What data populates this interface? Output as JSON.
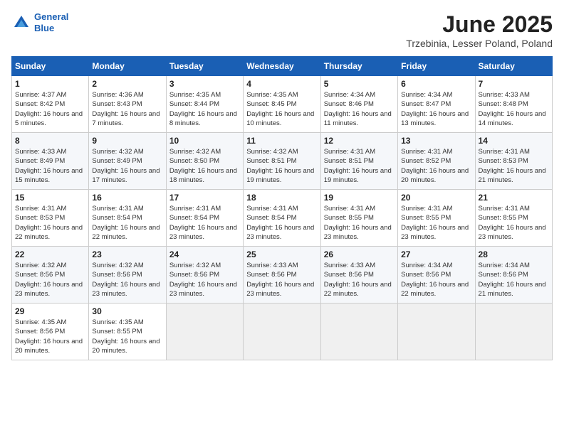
{
  "header": {
    "logo_line1": "General",
    "logo_line2": "Blue",
    "month": "June 2025",
    "location": "Trzebinia, Lesser Poland, Poland"
  },
  "columns": [
    "Sunday",
    "Monday",
    "Tuesday",
    "Wednesday",
    "Thursday",
    "Friday",
    "Saturday"
  ],
  "weeks": [
    [
      {
        "day": "1",
        "sunrise": "4:37 AM",
        "sunset": "8:42 PM",
        "daylight": "16 hours and 5 minutes."
      },
      {
        "day": "2",
        "sunrise": "4:36 AM",
        "sunset": "8:43 PM",
        "daylight": "16 hours and 7 minutes."
      },
      {
        "day": "3",
        "sunrise": "4:35 AM",
        "sunset": "8:44 PM",
        "daylight": "16 hours and 8 minutes."
      },
      {
        "day": "4",
        "sunrise": "4:35 AM",
        "sunset": "8:45 PM",
        "daylight": "16 hours and 10 minutes."
      },
      {
        "day": "5",
        "sunrise": "4:34 AM",
        "sunset": "8:46 PM",
        "daylight": "16 hours and 11 minutes."
      },
      {
        "day": "6",
        "sunrise": "4:34 AM",
        "sunset": "8:47 PM",
        "daylight": "16 hours and 13 minutes."
      },
      {
        "day": "7",
        "sunrise": "4:33 AM",
        "sunset": "8:48 PM",
        "daylight": "16 hours and 14 minutes."
      }
    ],
    [
      {
        "day": "8",
        "sunrise": "4:33 AM",
        "sunset": "8:49 PM",
        "daylight": "16 hours and 15 minutes."
      },
      {
        "day": "9",
        "sunrise": "4:32 AM",
        "sunset": "8:49 PM",
        "daylight": "16 hours and 17 minutes."
      },
      {
        "day": "10",
        "sunrise": "4:32 AM",
        "sunset": "8:50 PM",
        "daylight": "16 hours and 18 minutes."
      },
      {
        "day": "11",
        "sunrise": "4:32 AM",
        "sunset": "8:51 PM",
        "daylight": "16 hours and 19 minutes."
      },
      {
        "day": "12",
        "sunrise": "4:31 AM",
        "sunset": "8:51 PM",
        "daylight": "16 hours and 19 minutes."
      },
      {
        "day": "13",
        "sunrise": "4:31 AM",
        "sunset": "8:52 PM",
        "daylight": "16 hours and 20 minutes."
      },
      {
        "day": "14",
        "sunrise": "4:31 AM",
        "sunset": "8:53 PM",
        "daylight": "16 hours and 21 minutes."
      }
    ],
    [
      {
        "day": "15",
        "sunrise": "4:31 AM",
        "sunset": "8:53 PM",
        "daylight": "16 hours and 22 minutes."
      },
      {
        "day": "16",
        "sunrise": "4:31 AM",
        "sunset": "8:54 PM",
        "daylight": "16 hours and 22 minutes."
      },
      {
        "day": "17",
        "sunrise": "4:31 AM",
        "sunset": "8:54 PM",
        "daylight": "16 hours and 23 minutes."
      },
      {
        "day": "18",
        "sunrise": "4:31 AM",
        "sunset": "8:54 PM",
        "daylight": "16 hours and 23 minutes."
      },
      {
        "day": "19",
        "sunrise": "4:31 AM",
        "sunset": "8:55 PM",
        "daylight": "16 hours and 23 minutes."
      },
      {
        "day": "20",
        "sunrise": "4:31 AM",
        "sunset": "8:55 PM",
        "daylight": "16 hours and 23 minutes."
      },
      {
        "day": "21",
        "sunrise": "4:31 AM",
        "sunset": "8:55 PM",
        "daylight": "16 hours and 23 minutes."
      }
    ],
    [
      {
        "day": "22",
        "sunrise": "4:32 AM",
        "sunset": "8:56 PM",
        "daylight": "16 hours and 23 minutes."
      },
      {
        "day": "23",
        "sunrise": "4:32 AM",
        "sunset": "8:56 PM",
        "daylight": "16 hours and 23 minutes."
      },
      {
        "day": "24",
        "sunrise": "4:32 AM",
        "sunset": "8:56 PM",
        "daylight": "16 hours and 23 minutes."
      },
      {
        "day": "25",
        "sunrise": "4:33 AM",
        "sunset": "8:56 PM",
        "daylight": "16 hours and 23 minutes."
      },
      {
        "day": "26",
        "sunrise": "4:33 AM",
        "sunset": "8:56 PM",
        "daylight": "16 hours and 22 minutes."
      },
      {
        "day": "27",
        "sunrise": "4:34 AM",
        "sunset": "8:56 PM",
        "daylight": "16 hours and 22 minutes."
      },
      {
        "day": "28",
        "sunrise": "4:34 AM",
        "sunset": "8:56 PM",
        "daylight": "16 hours and 21 minutes."
      }
    ],
    [
      {
        "day": "29",
        "sunrise": "4:35 AM",
        "sunset": "8:56 PM",
        "daylight": "16 hours and 20 minutes."
      },
      {
        "day": "30",
        "sunrise": "4:35 AM",
        "sunset": "8:55 PM",
        "daylight": "16 hours and 20 minutes."
      },
      null,
      null,
      null,
      null,
      null
    ]
  ]
}
